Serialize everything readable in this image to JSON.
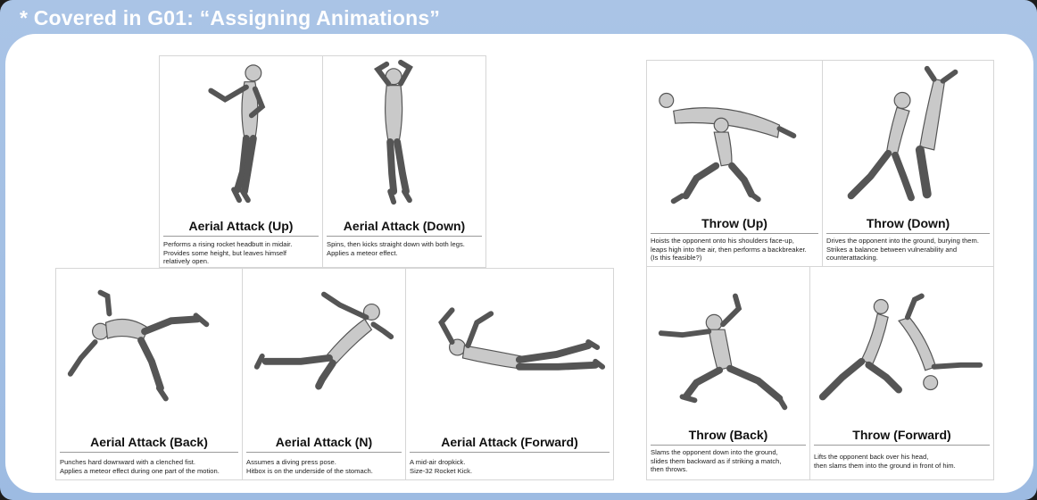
{
  "header": {
    "title": "* Covered in G01: “Assigning Animations”"
  },
  "cards": [
    {
      "title": "Aerial Attack (Up)",
      "description": "Performs a rising rocket headbutt in midair.\nProvides some height, but leaves himself\nrelatively open."
    },
    {
      "title": "Aerial Attack (Down)",
      "description": "Spins, then kicks straight down with both legs.\nApplies a meteor effect."
    },
    {
      "title": "Aerial Attack (Back)",
      "description": "Punches hard downward with a clenched fist.\nApplies a meteor effect during one part of the motion."
    },
    {
      "title": "Aerial Attack (N)",
      "description": "Assumes a diving press pose.\nHitbox is on the underside of the stomach."
    },
    {
      "title": "Aerial Attack (Forward)",
      "description": "A mid-air dropkick.\nSize-32 Rocket Kick."
    },
    {
      "title": "Throw (Up)",
      "description": "Hoists the opponent onto his shoulders face-up,\nleaps high into the air, then performs a backbreaker.\n(Is this feasible?)"
    },
    {
      "title": "Throw (Down)",
      "description": "Drives the opponent into the ground, burying them.\nStrikes a balance between vulnerability and\ncounterattacking."
    },
    {
      "title": "Throw (Back)",
      "description": "Slams the opponent down into the ground,\nslides them backward as if striking a match,\nthen throws."
    },
    {
      "title": "Throw (Forward)",
      "description": "Lifts the opponent back over his head,\nthen slams them into the ground in front of him."
    }
  ]
}
